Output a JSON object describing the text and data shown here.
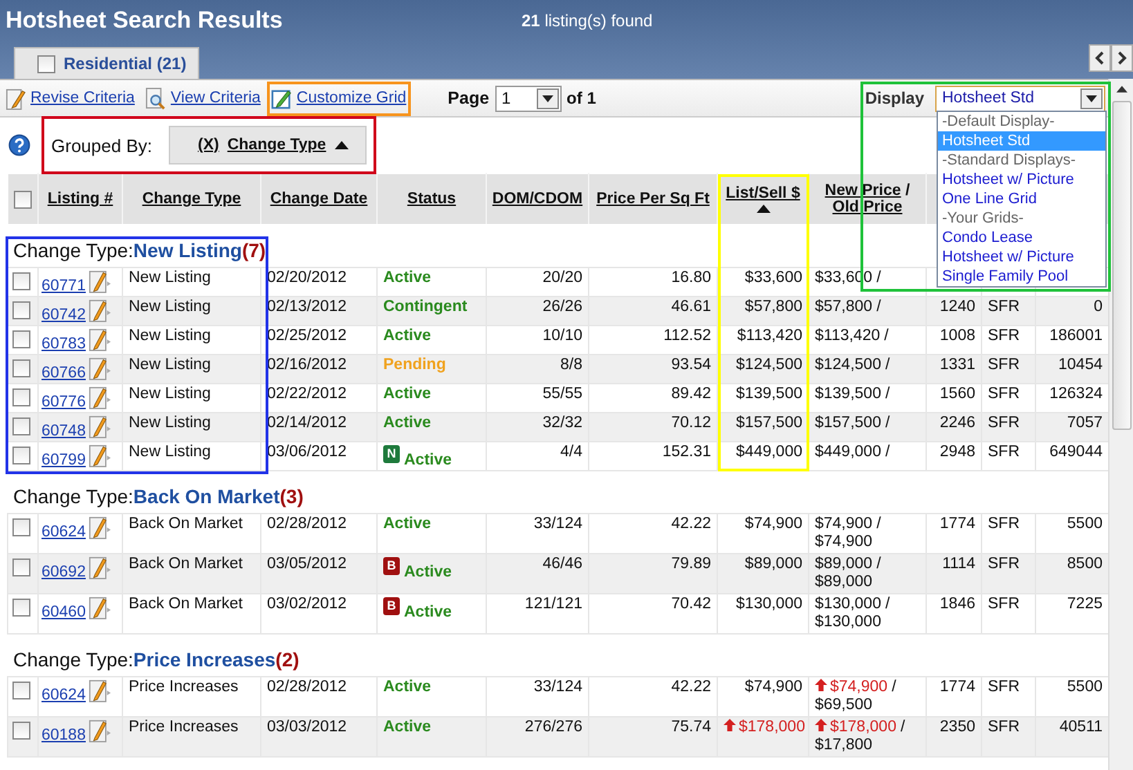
{
  "header": {
    "title": "Hotsheet Search Results",
    "count": "**21** listing(s) found"
  },
  "tabs": [
    {
      "label": "Residential (21)",
      "selected": true,
      "checked": false
    }
  ],
  "toolbar": {
    "links": [
      {
        "label": "Revise Criteria",
        "kind": "revise"
      },
      {
        "label": "View Criteria",
        "kind": "view"
      },
      {
        "label": "Customize Grid",
        "kind": "customize",
        "color": "#f7941d"
      }
    ],
    "page": {
      "label": "Page",
      "value": "1",
      "total": "of 1"
    },
    "display": {
      "label": "Display",
      "value": "Hotsheet Std",
      "expanded": true,
      "color": "#1fc23a",
      "options": [
        {
          "label": "-Default Display-",
          "kind": "heading",
          "selected": false
        },
        {
          "label": "Hotsheet Std",
          "kind": "option",
          "selected": true
        },
        {
          "label": "-Standard Displays-",
          "kind": "heading",
          "selected": false
        },
        {
          "label": "Hotsheet w/ Picture",
          "kind": "option",
          "selected": false
        },
        {
          "label": "One Line Grid",
          "kind": "option",
          "selected": false
        },
        {
          "label": "-Your Grids-",
          "kind": "heading",
          "selected": false
        },
        {
          "label": "Condo Lease",
          "kind": "option",
          "selected": false
        },
        {
          "label": "Hotsheet w/ Picture",
          "kind": "option",
          "selected": false
        },
        {
          "label": "Single Family Pool",
          "kind": "option",
          "selected": false
        }
      ]
    }
  },
  "grouped_by": {
    "label": "Grouped By:",
    "remove": "(X)",
    "field": "Change Type",
    "color": "#d0021b"
  },
  "select_all": {
    "checked": false
  },
  "columns": [
    {
      "label": "Listing #",
      "sorted": false
    },
    {
      "label": "Change Type",
      "sorted": false
    },
    {
      "label": "Change Date",
      "sorted": false
    },
    {
      "label": "Status",
      "sorted": false
    },
    {
      "label": "DOM/CDOM",
      "sorted": false
    },
    {
      "label": "Price Per Sq Ft",
      "sorted": false
    },
    {
      "label": "List/Sell $",
      "sorted": true,
      "color": "#ffff00"
    },
    {
      "label": "New Price",
      "separator": "/",
      "label_2": "Old Price",
      "sorted": false
    }
  ],
  "groups": [
    {
      "label": "Change Type:",
      "name": "New Listing",
      "count": "(7)",
      "color": "#2233e8",
      "rows": [
        {
          "checked": false,
          "listing": "60771",
          "change_type": "New Listing",
          "change_date": "02/20/2012",
          "status": "Active",
          "color": "#2a8a1e",
          "dom": "20/20",
          "ppsf": "16.80",
          "list_price": "$33,600",
          "list_up": false,
          "new_price": "$33,600",
          "new_up": false,
          "sep": "/"
        },
        {
          "checked": false,
          "listing": "60742",
          "change_type": "New Listing",
          "change_date": "02/13/2012",
          "status": "Contingent",
          "color": "#2a8a1e",
          "dom": "26/26",
          "ppsf": "46.61",
          "list_price": "$57,800",
          "list_up": false,
          "new_price": "$57,800",
          "new_up": false,
          "sep": "/",
          "sqft": "1240",
          "type": "SFR",
          "lot": "0"
        },
        {
          "checked": false,
          "listing": "60783",
          "change_type": "New Listing",
          "change_date": "02/25/2012",
          "status": "Active",
          "color": "#2a8a1e",
          "dom": "10/10",
          "ppsf": "112.52",
          "list_price": "$113,420",
          "list_up": false,
          "new_price": "$113,420",
          "new_up": false,
          "sep": "/",
          "sqft": "1008",
          "type": "SFR",
          "lot": "186001"
        },
        {
          "checked": false,
          "listing": "60766",
          "change_type": "New Listing",
          "change_date": "02/16/2012",
          "status": "Pending",
          "color": "#f0a21e",
          "dom": "8/8",
          "ppsf": "93.54",
          "list_price": "$124,500",
          "list_up": false,
          "new_price": "$124,500",
          "new_up": false,
          "sep": "/",
          "sqft": "1331",
          "type": "SFR",
          "lot": "10454"
        },
        {
          "checked": false,
          "listing": "60776",
          "change_type": "New Listing",
          "change_date": "02/22/2012",
          "status": "Active",
          "color": "#2a8a1e",
          "dom": "55/55",
          "ppsf": "89.42",
          "list_price": "$139,500",
          "list_up": false,
          "new_price": "$139,500",
          "new_up": false,
          "sep": "/",
          "sqft": "1560",
          "type": "SFR",
          "lot": "126324"
        },
        {
          "checked": false,
          "listing": "60748",
          "change_type": "New Listing",
          "change_date": "02/14/2012",
          "status": "Active",
          "color": "#2a8a1e",
          "dom": "32/32",
          "ppsf": "70.12",
          "list_price": "$157,500",
          "list_up": false,
          "new_price": "$157,500",
          "new_up": false,
          "sep": "/",
          "sqft": "2246",
          "type": "SFR",
          "lot": "7057"
        },
        {
          "checked": false,
          "listing": "60799",
          "change_type": "New Listing",
          "change_date": "03/06/2012",
          "badge": {
            "letter": "N",
            "color": "#1e7a3c"
          },
          "status": "Active",
          "color": "#2a8a1e",
          "dom": "4/4",
          "ppsf": "152.31",
          "list_price": "$449,000",
          "list_up": false,
          "new_price": "$449,000",
          "new_up": false,
          "sep": "/",
          "sqft": "2948",
          "type": "SFR",
          "lot": "649044"
        }
      ]
    },
    {
      "label": "Change Type:",
      "name": "Back On Market",
      "count": "(3)",
      "rows": [
        {
          "checked": false,
          "listing": "60624",
          "change_type": "Back On Market",
          "change_date": "02/28/2012",
          "status": "Active",
          "color": "#2a8a1e",
          "dom": "33/124",
          "ppsf": "42.22",
          "list_price": "$74,900",
          "list_up": false,
          "new_price": "$74,900",
          "new_up": false,
          "sep": "/",
          "old_price": "$74,900",
          "sqft": "1774",
          "type": "SFR",
          "lot": "5500"
        },
        {
          "checked": false,
          "listing": "60692",
          "change_type": "Back On Market",
          "change_date": "03/05/2012",
          "badge": {
            "letter": "B",
            "color": "#a01010"
          },
          "status": "Active",
          "color": "#2a8a1e",
          "dom": "46/46",
          "ppsf": "79.89",
          "list_price": "$89,000",
          "list_up": false,
          "new_price": "$89,000",
          "new_up": false,
          "sep": "/",
          "old_price": "$89,000",
          "sqft": "1114",
          "type": "SFR",
          "lot": "8500"
        },
        {
          "checked": false,
          "listing": "60460",
          "change_type": "Back On Market",
          "change_date": "03/02/2012",
          "badge": {
            "letter": "B",
            "color": "#a01010"
          },
          "status": "Active",
          "color": "#2a8a1e",
          "dom": "121/121",
          "ppsf": "70.42",
          "list_price": "$130,000",
          "list_up": false,
          "new_price": "$130,000",
          "new_up": false,
          "sep": "/",
          "old_price": "$130,000",
          "sqft": "1846",
          "type": "SFR",
          "lot": "7225"
        }
      ]
    },
    {
      "label": "Change Type:",
      "name": "Price Increases",
      "count": "(2)",
      "rows": [
        {
          "checked": false,
          "listing": "60624",
          "change_type": "Price Increases",
          "change_date": "02/28/2012",
          "status": "Active",
          "color": "#2a8a1e",
          "dom": "33/124",
          "ppsf": "42.22",
          "list_price": "$74,900",
          "list_up": false,
          "new_price": "$74,900",
          "new_up": true,
          "sep": "/",
          "old_price": "$69,500",
          "sqft": "1774",
          "type": "SFR",
          "lot": "5500"
        },
        {
          "checked": false,
          "listing": "60188",
          "change_type": "Price Increases",
          "change_date": "03/03/2012",
          "status": "Active",
          "color": "#2a8a1e",
          "dom": "276/276",
          "ppsf": "75.74",
          "list_price": "$178,000",
          "list_up": true,
          "new_price": "$178,000",
          "new_up": true,
          "sep": "/",
          "old_price": "$17,800",
          "sqft": "2350",
          "type": "SFR",
          "lot": "40511"
        }
      ]
    }
  ]
}
